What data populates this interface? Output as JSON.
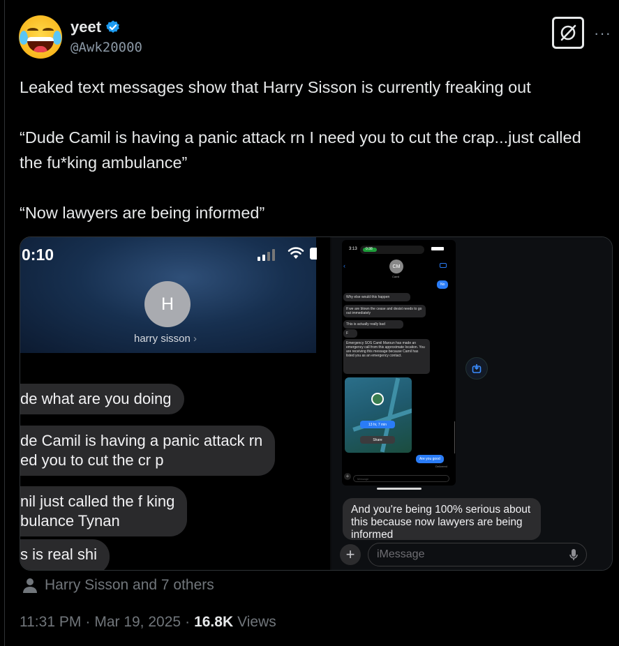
{
  "author": {
    "name": "yeet",
    "handle": "@Awk20000",
    "verified": true,
    "avatar_icon": "face-with-tears-of-joy-icon"
  },
  "header": {
    "grok_icon": "grok-icon",
    "more_label": "···"
  },
  "tweet": {
    "lines": [
      "Leaked text messages show that Harry Sisson is currently freaking out",
      "“Dude Camil is having a panic attack rn I need you to cut the crap...just called the fu*king ambulance”",
      "“Now lawyers are being informed”"
    ]
  },
  "media": {
    "shot1": {
      "time": "0:10",
      "contact_initial": "H",
      "contact_name": "harry sisson",
      "messages": [
        [
          "de what are you doing"
        ],
        [
          "de Camil is having a panic attack rn",
          "ed you to cut the cr  p"
        ],
        [
          "nil just called the f   king",
          "bulance Tynan"
        ],
        [
          "s is real shi"
        ]
      ]
    },
    "shot2": {
      "status_time": "3:13",
      "call_time": "0:38",
      "contact_initials": "CM",
      "contact_name": "Camil",
      "sent_no": "No",
      "received": [
        "Why else would this happen",
        "If we are blown the cease and desist needs to go out immediately",
        "This is actually really bad",
        "F",
        "Emergency SOS Camil Maroun has made an emergency call from this approximate location. You are receiving this message because Camil has listed you as an emergency contact."
      ],
      "map_drive": "13 hr, 7 min",
      "map_share": "Share",
      "sent_good": "Are you good",
      "delivered": "Delivered",
      "mini_placeholder": "Message",
      "big_message": "And you're being 100% serious about this because now lawyers are being informed",
      "plus_label": "+",
      "input_placeholder": "iMessage"
    }
  },
  "liked_by": "Harry Sisson and 7 others",
  "meta": {
    "time": "11:31 PM",
    "date": "Mar 19, 2025",
    "views_count": "16.8K",
    "views_label": "Views"
  },
  "colors": {
    "background": "#000000",
    "text": "#e7e9ea",
    "muted": "#71767b",
    "verified": "#1d9bf0",
    "imessage_blue": "#2a7cf6"
  }
}
